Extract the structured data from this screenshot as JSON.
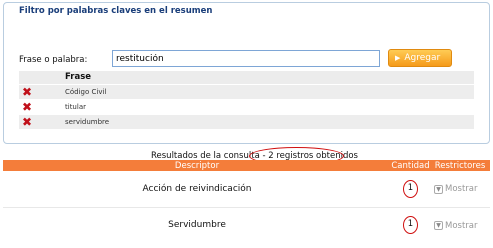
{
  "filter": {
    "title": "Filtro por palabras claves en el resumen",
    "frase_label": "Frase o palabra:",
    "input_value": "restitución",
    "agregar_label": "Agregar",
    "table_header": "Frase",
    "phrases": [
      "Código Civil",
      "titular",
      "servidumbre"
    ]
  },
  "results": {
    "summary_prefix": "Resultados de la consulta ",
    "summary_count": "- 2 registros obtenidos",
    "headers": {
      "descriptor": "Descriptor",
      "cantidad": "Cantidad",
      "restrictores": "Restrictores"
    },
    "rows": [
      {
        "descriptor": "Acción de reivindicación",
        "cantidad": "1",
        "action": "Mostrar"
      },
      {
        "descriptor": "Servidumbre",
        "cantidad": "1",
        "action": "Mostrar"
      }
    ]
  },
  "colors": {
    "header_orange": "#f47d3a",
    "button_orange": "#f59a1a",
    "title_blue": "#1a3e7a",
    "delete_red": "#c0101a",
    "annotation_red": "#d01010"
  }
}
